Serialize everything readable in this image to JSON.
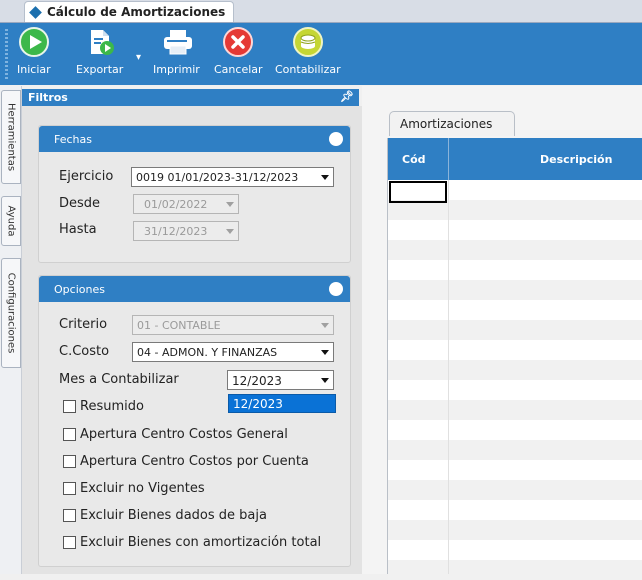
{
  "window": {
    "tab_title": "Cálculo de Amortizaciones"
  },
  "toolbar": {
    "buttons": [
      {
        "label": "Iniciar",
        "icon": "play-icon",
        "color": "#3cb84a"
      },
      {
        "label": "Exportar",
        "icon": "export-icon",
        "color": "#ffffff"
      },
      {
        "label": "Imprimir",
        "icon": "printer-icon",
        "color": "#ffffff"
      },
      {
        "label": "Cancelar",
        "icon": "cancel-icon",
        "color": "#e53935"
      },
      {
        "label": "Contabilizar",
        "icon": "coins-icon",
        "color": "#c5d634"
      }
    ]
  },
  "sidebar_tabs": [
    "Herramientas",
    "Ayuda",
    "Configuraciones"
  ],
  "filtros": {
    "title": "Filtros",
    "fechas": {
      "title": "Fechas",
      "ejercicio_label": "Ejercicio",
      "ejercicio_value": "0019 01/01/2023-31/12/2023",
      "desde_label": "Desde",
      "desde_value": "01/02/2022",
      "hasta_label": "Hasta",
      "hasta_value": "31/12/2023"
    },
    "opciones": {
      "title": "Opciones",
      "criterio_label": "Criterio",
      "criterio_value": "01 - CONTABLE",
      "ccosto_label": "C.Costo",
      "ccosto_value": "04 - ADMON. Y FINANZAS",
      "mes_label": "Mes a Contabilizar",
      "mes_value": "12/2023",
      "mes_dropdown_option": "12/2023",
      "checks": [
        {
          "label": "Resumido",
          "checked": false
        },
        {
          "label": "Apertura Centro Costos General",
          "checked": false
        },
        {
          "label": "Apertura Centro Costos por Cuenta",
          "checked": false
        },
        {
          "label": "Excluir no Vigentes",
          "checked": false
        },
        {
          "label": "Excluir Bienes dados de baja",
          "checked": false
        },
        {
          "label": "Excluir Bienes con amortización total",
          "checked": false
        }
      ]
    }
  },
  "grid": {
    "tab_label": "Amortizaciones",
    "columns": [
      "Cód",
      "Descripción"
    ]
  },
  "colors": {
    "accent": "#2f7fc4",
    "selection": "#0a72d6"
  }
}
